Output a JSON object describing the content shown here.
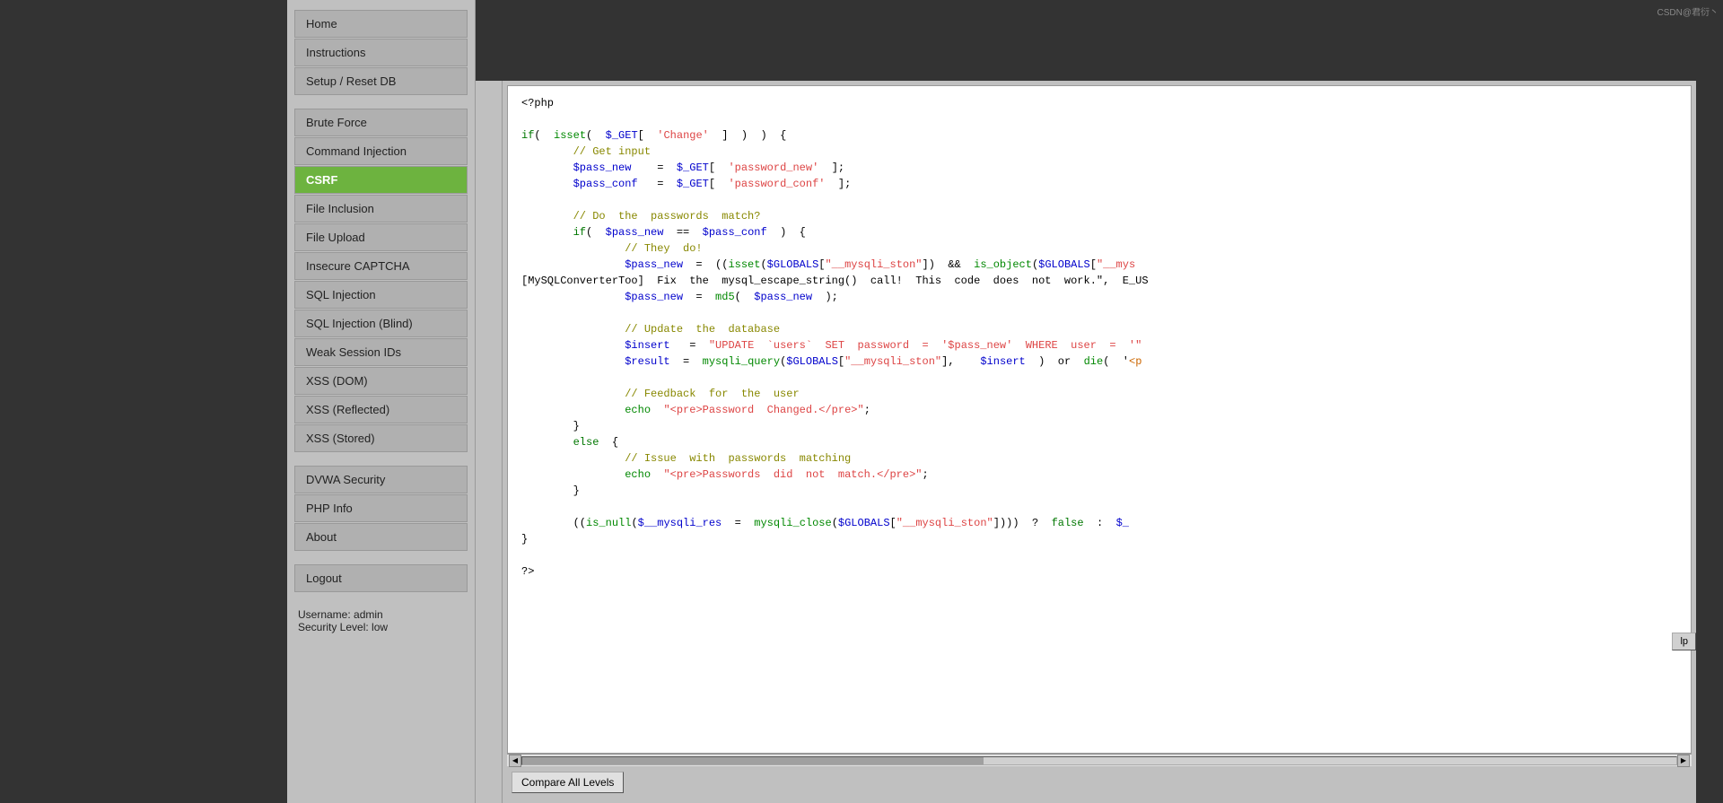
{
  "sidebar": {
    "top_items": [
      {
        "label": "Home",
        "id": "home",
        "active": false
      },
      {
        "label": "Instructions",
        "id": "instructions",
        "active": false
      },
      {
        "label": "Setup / Reset DB",
        "id": "setup",
        "active": false
      }
    ],
    "vulnerability_items": [
      {
        "label": "Brute Force",
        "id": "brute-force",
        "active": false
      },
      {
        "label": "Command Injection",
        "id": "command-injection",
        "active": false
      },
      {
        "label": "CSRF",
        "id": "csrf",
        "active": true
      },
      {
        "label": "File Inclusion",
        "id": "file-inclusion",
        "active": false
      },
      {
        "label": "File Upload",
        "id": "file-upload",
        "active": false
      },
      {
        "label": "Insecure CAPTCHA",
        "id": "insecure-captcha",
        "active": false
      },
      {
        "label": "SQL Injection",
        "id": "sql-injection",
        "active": false
      },
      {
        "label": "SQL Injection (Blind)",
        "id": "sql-injection-blind",
        "active": false
      },
      {
        "label": "Weak Session IDs",
        "id": "weak-session-ids",
        "active": false
      },
      {
        "label": "XSS (DOM)",
        "id": "xss-dom",
        "active": false
      },
      {
        "label": "XSS (Reflected)",
        "id": "xss-reflected",
        "active": false
      },
      {
        "label": "XSS (Stored)",
        "id": "xss-stored",
        "active": false
      }
    ],
    "bottom_items": [
      {
        "label": "DVWA Security",
        "id": "dvwa-security",
        "active": false
      },
      {
        "label": "PHP Info",
        "id": "php-info",
        "active": false
      },
      {
        "label": "About",
        "id": "about",
        "active": false
      }
    ],
    "logout": {
      "label": "Logout",
      "id": "logout"
    },
    "username_label": "Username:",
    "username_value": "admin",
    "security_label": "Security Level:",
    "security_value": "low"
  },
  "code": {
    "lines": [
      "<?php",
      "",
      "if(  isset(  $_GET[  'Change'  ]  )  )  {",
      "        // Get input",
      "        $pass_new    =  $_GET[  'password_new'  ];",
      "        $pass_conf   =  $_GET[  'password_conf'  ];",
      "",
      "        // Do  the  passwords  match?",
      "        if(  $pass_new  ==  $pass_conf  )  {",
      "                // They  do!",
      "                $pass_new  =  ((isset($GLOBALS[\"__mysqli_ston\"])  &&  is_object($GLOBALS[\"__mys",
      "[MySQLConverterToo]  Fix  the  mysql_escape_string()  call!  This  code  does  not  work.\",  E_US",
      "                $pass_new  =  md5(  $pass_new  );",
      "",
      "                // Update  the  database",
      "                $insert   =  \"UPDATE  `users`  SET  password  =  '$pass_new'  WHERE  user  =  '\"",
      "                $result  =  mysqli_query($GLOBALS[\"__mysqli_ston\"],    $insert  )  or  die(  '<p",
      "",
      "                // Feedback  for  the  user",
      "                echo  \"<pre>Password  Changed.</pre>\";",
      "        }",
      "        else  {",
      "                // Issue  with  passwords  matching",
      "                echo  \"<pre>Passwords  did  not  match.</pre>\";",
      "        }",
      "",
      "        ((is_null($_mysqli_res  =  mysqli_close($GLOBALS[\"__mysqli_ston\"])))  ?  false  :  $_",
      "}",
      "",
      "?>"
    ]
  },
  "buttons": {
    "compare_all_levels": "Compare All Levels"
  },
  "help_button": "lp",
  "watermark": "CSDN@君衍丶"
}
